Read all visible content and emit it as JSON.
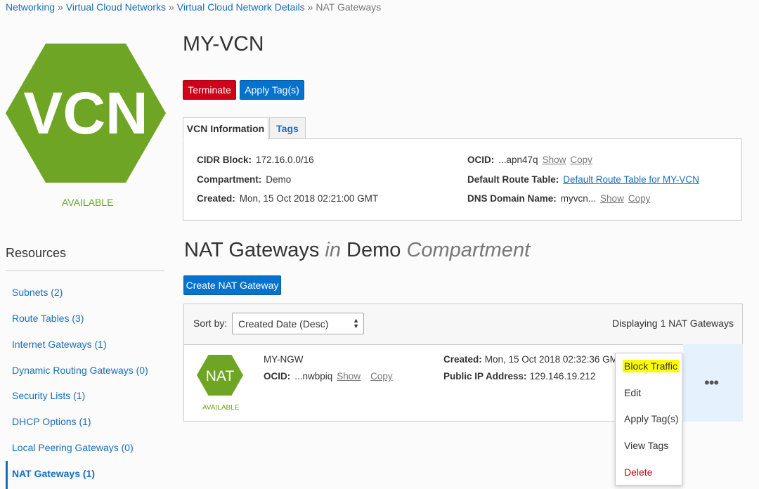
{
  "breadcrumb": {
    "items": [
      "Networking",
      "Virtual Cloud Networks",
      "Virtual Cloud Network Details"
    ],
    "separator": "»",
    "current": "NAT Gateways"
  },
  "vcn": {
    "logo_text": "VCN",
    "status": "AVAILABLE",
    "title": "MY-VCN",
    "buttons": {
      "terminate": "Terminate",
      "apply_tags": "Apply Tag(s)"
    },
    "tabs": {
      "info": "VCN Information",
      "tags": "Tags"
    },
    "info": {
      "cidr_label": "CIDR Block:",
      "cidr_value": "172.16.0.0/16",
      "compartment_label": "Compartment:",
      "compartment_value": "Demo",
      "created_label": "Created:",
      "created_value": "Mon, 15 Oct 2018 02:21:00 GMT",
      "ocid_label": "OCID:",
      "ocid_value": "...apn47q",
      "show": "Show",
      "copy": "Copy",
      "route_table_label": "Default Route Table:",
      "route_table_value": "Default Route Table for MY-VCN",
      "dns_label": "DNS Domain Name:",
      "dns_value": "myvcn..."
    }
  },
  "resources": {
    "title": "Resources",
    "items": [
      {
        "label": "Subnets (2)"
      },
      {
        "label": "Route Tables (3)"
      },
      {
        "label": "Internet Gateways (1)"
      },
      {
        "label": "Dynamic Routing Gateways (0)"
      },
      {
        "label": "Security Lists (1)"
      },
      {
        "label": "DHCP Options (1)"
      },
      {
        "label": "Local Peering Gateways (0)"
      },
      {
        "label": "NAT Gateways (1)"
      }
    ]
  },
  "nat": {
    "section_title": {
      "a": "NAT Gateways",
      "in": "in",
      "compartment": "Demo",
      "suffix": "Compartment"
    },
    "create_button": "Create NAT Gateway",
    "sort_label": "Sort by:",
    "sort_value": "Created Date (Desc)",
    "display_count": "Displaying 1 NAT Gateways",
    "row": {
      "logo_text": "NAT",
      "status": "AVAILABLE",
      "name": "MY-NGW",
      "ocid_label": "OCID:",
      "ocid_value": "...nwbpiq",
      "show": "Show",
      "copy": "Copy",
      "created_label": "Created:",
      "created_value": "Mon, 15 Oct 2018 02:32:36 GMT",
      "ip_label": "Public IP Address:",
      "ip_value": "129.146.19.212"
    },
    "menu": {
      "items": [
        "Block Traffic",
        "Edit",
        "Apply Tag(s)",
        "View Tags",
        "Delete"
      ]
    }
  },
  "colors": {
    "brand_green": "#6ea524",
    "primary_blue": "#0572ce",
    "danger_red": "#d0021b",
    "highlight": "#ffff00"
  }
}
